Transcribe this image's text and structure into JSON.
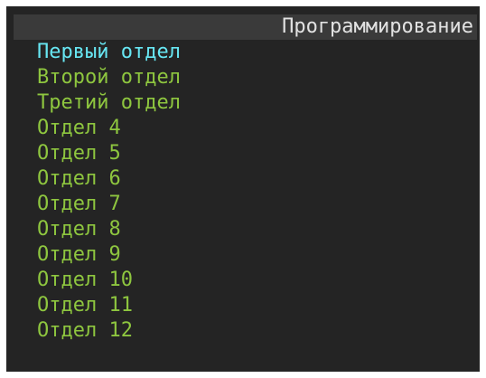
{
  "header": {
    "title": "Программирование"
  },
  "menu": {
    "items": [
      {
        "label": "Первый отдел"
      },
      {
        "label": "Второй отдел"
      },
      {
        "label": "Третий отдел"
      },
      {
        "label": "Отдел 4"
      },
      {
        "label": "Отдел 5"
      },
      {
        "label": "Отдел 6"
      },
      {
        "label": "Отдел 7"
      },
      {
        "label": "Отдел 8"
      },
      {
        "label": "Отдел 9"
      },
      {
        "label": "Отдел 10"
      },
      {
        "label": "Отдел 11"
      },
      {
        "label": "Отдел 12"
      }
    ],
    "selected_index": 0
  },
  "colors": {
    "background": "#242424",
    "title_bar": "#3a3a3a",
    "title_text": "#e2e2e2",
    "item_text": "#8ec63f",
    "selected_text": "#67e6f2"
  }
}
